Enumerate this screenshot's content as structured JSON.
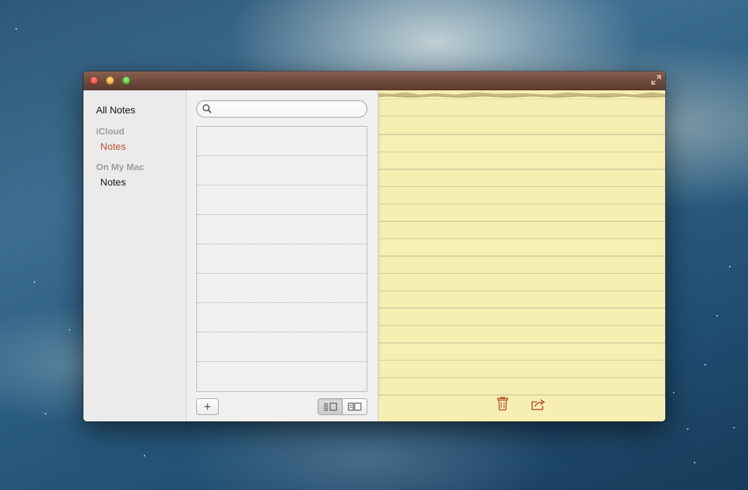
{
  "sidebar": {
    "all_notes": "All Notes",
    "groups": [
      {
        "heading": "iCloud",
        "items": [
          "Notes"
        ]
      },
      {
        "heading": "On My Mac",
        "items": [
          "Notes"
        ]
      }
    ]
  },
  "list": {
    "search_placeholder": "",
    "add_label": "+",
    "row_count": 9
  },
  "note": {
    "selected_folder": "iCloud Notes"
  },
  "colors": {
    "titlebar": "#6e4a3c",
    "selected_accent": "#b5532f",
    "paper": "#f6efb1"
  },
  "icons": [
    "search-icon",
    "plus-icon",
    "list-view-icon",
    "column-view-icon",
    "trash-icon",
    "share-icon",
    "fullscreen-icon"
  ]
}
